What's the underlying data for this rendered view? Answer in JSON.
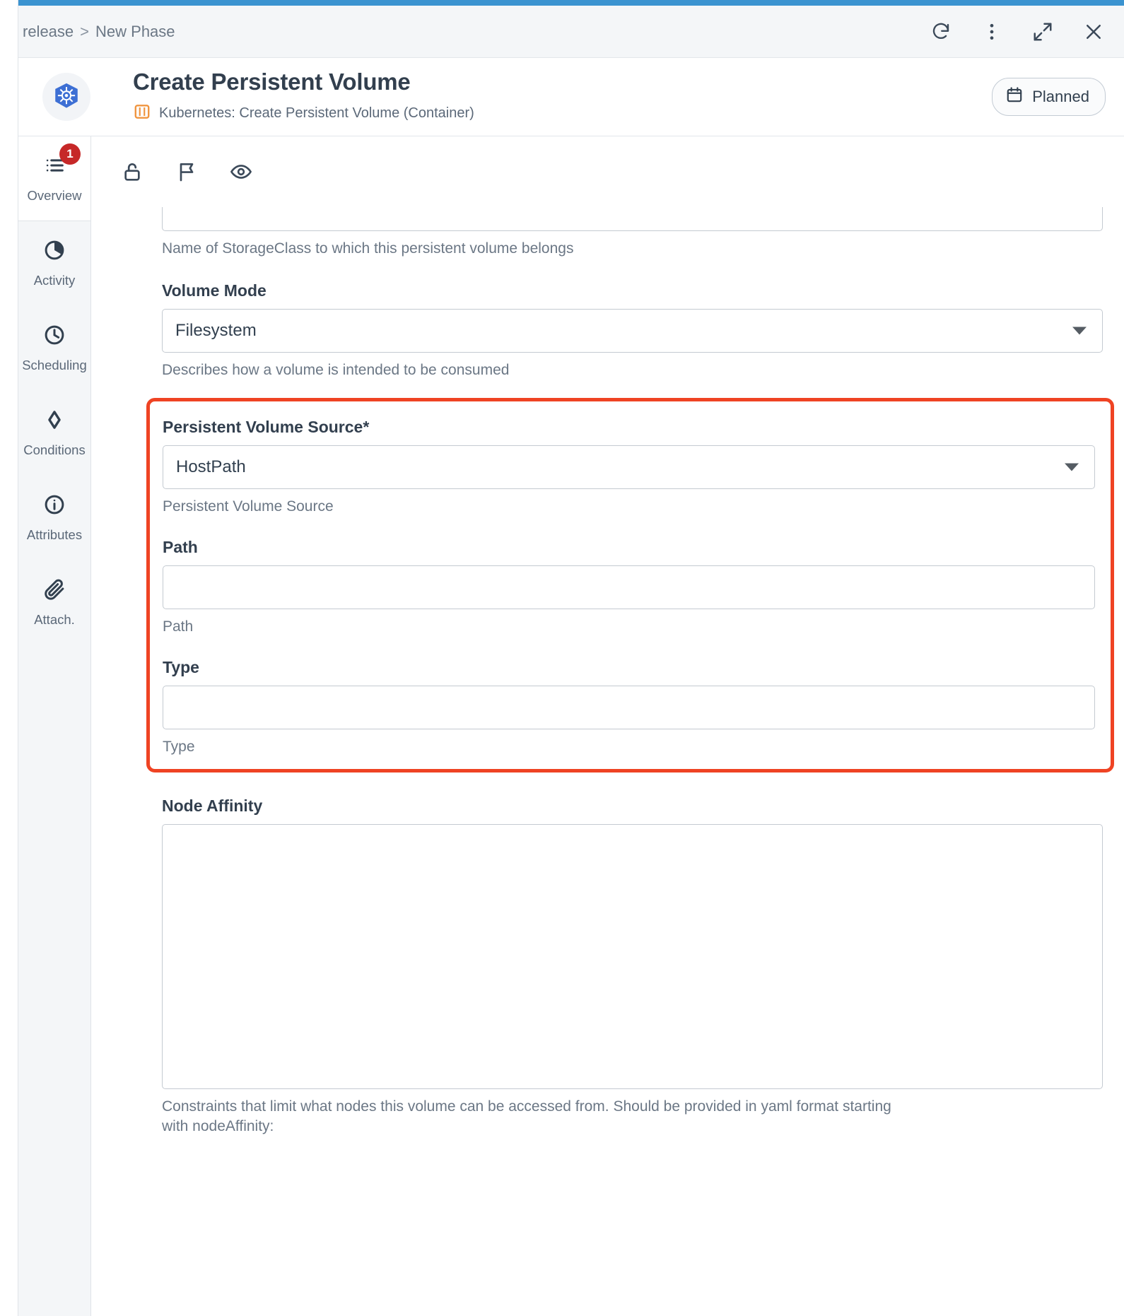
{
  "window": {
    "breadcrumb": {
      "parent": "release",
      "separator": ">",
      "current": "New Phase"
    },
    "actions": [
      {
        "name": "refresh",
        "label": "Refresh"
      },
      {
        "name": "more-options",
        "label": "More options"
      },
      {
        "name": "expand",
        "label": "Expand"
      },
      {
        "name": "close",
        "label": "Close"
      }
    ],
    "accent_color": "#3b93d0"
  },
  "header": {
    "icon": "kubernetes-logo",
    "title": "Create Persistent Volume",
    "subtitle_icon": "container-icon",
    "subtitle": "Kubernetes: Create Persistent Volume (Container)",
    "status": {
      "icon": "calendar-icon",
      "label": "Planned"
    }
  },
  "sidebar": {
    "items": [
      {
        "icon": "list-icon",
        "label": "Overview",
        "badge": "1",
        "active": true
      },
      {
        "icon": "pie-chart-icon",
        "label": "Activity",
        "badge": null,
        "active": false
      },
      {
        "icon": "clock-icon",
        "label": "Scheduling",
        "badge": null,
        "active": false
      },
      {
        "icon": "diamond-icon",
        "label": "Conditions",
        "badge": null,
        "active": false
      },
      {
        "icon": "info-icon",
        "label": "Attributes",
        "badge": null,
        "active": false
      },
      {
        "icon": "paperclip-icon",
        "label": "Attach.",
        "badge": null,
        "active": false
      }
    ]
  },
  "toolbar": {
    "buttons": [
      {
        "icon": "unlock-icon",
        "label": "Lock"
      },
      {
        "icon": "flag-icon",
        "label": "Flag"
      },
      {
        "icon": "eye-icon",
        "label": "Watch"
      }
    ]
  },
  "form": {
    "storage_class_help": "Name of StorageClass to which this persistent volume belongs",
    "volume_mode": {
      "label": "Volume Mode",
      "value": "Filesystem",
      "help": "Describes how a volume is intended to be consumed"
    },
    "persistent_volume_source": {
      "label": "Persistent Volume Source",
      "required_marker": "*",
      "value": "HostPath",
      "help": "Persistent Volume Source",
      "highlight_color": "#ef4323"
    },
    "path": {
      "label": "Path",
      "value": "",
      "placeholder": "",
      "help": "Path"
    },
    "type": {
      "label": "Type",
      "value": "",
      "placeholder": "",
      "help": "Type"
    },
    "node_affinity": {
      "label": "Node Affinity",
      "value": "",
      "placeholder": "",
      "help": "Constraints that limit what nodes this volume can be accessed from. Should be provided in yaml format starting with nodeAffinity:"
    }
  }
}
